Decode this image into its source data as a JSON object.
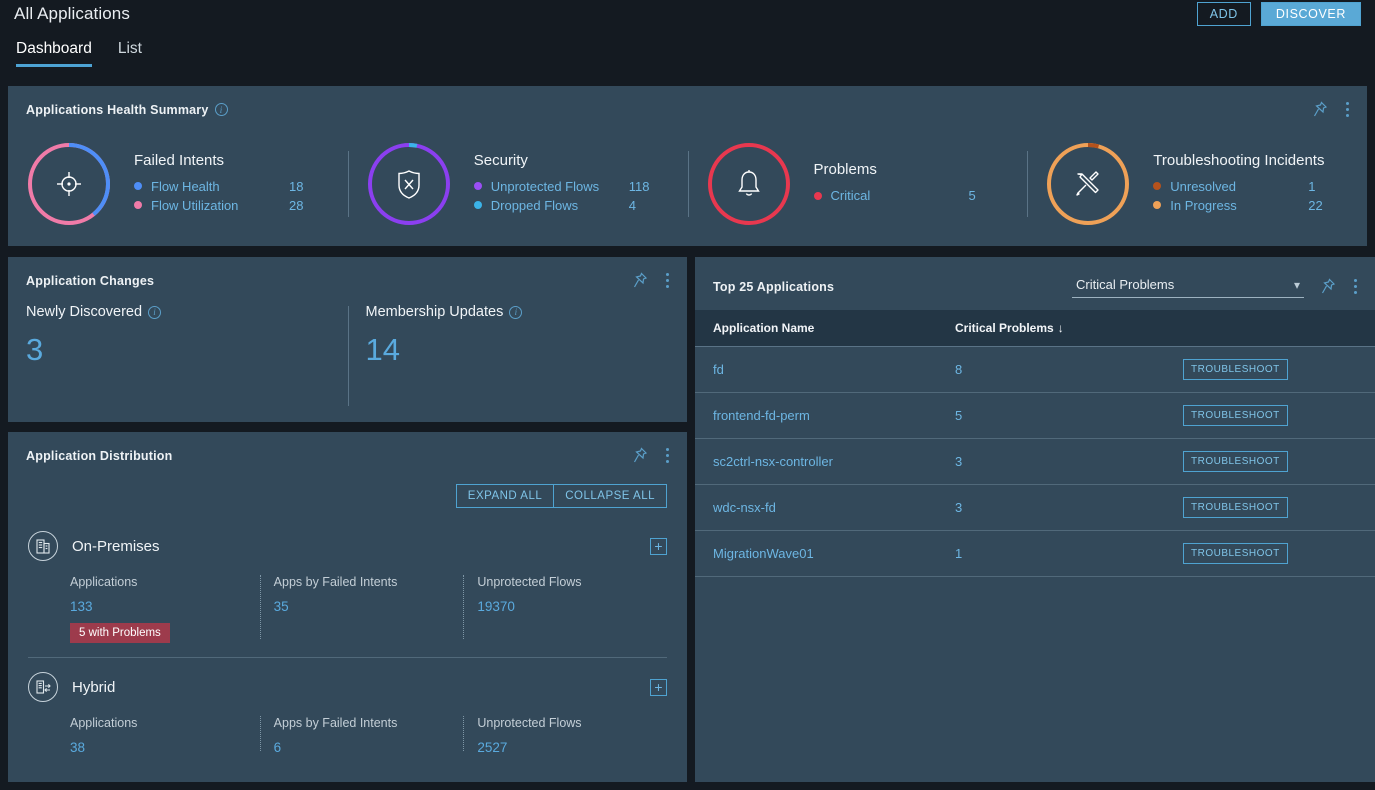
{
  "header": {
    "title": "All Applications",
    "add_label": "ADD",
    "discover_label": "DISCOVER",
    "tabs": [
      {
        "label": "Dashboard",
        "active": true
      },
      {
        "label": "List",
        "active": false
      }
    ]
  },
  "health_summary": {
    "title": "Applications Health Summary",
    "info_glyph": "i",
    "items": [
      {
        "name": "Failed Intents",
        "icon": "target-icon",
        "ring_colors": [
          "#f07ba8",
          "#4e8ef7"
        ],
        "legend": [
          {
            "label": "Flow Health",
            "value": "18",
            "color": "#4e8ef7"
          },
          {
            "label": "Flow Utilization",
            "value": "28",
            "color": "#f07ba8"
          }
        ]
      },
      {
        "name": "Security",
        "icon": "shield-x-icon",
        "ring_colors": [
          "#8b3ff0",
          "#3bb3e8"
        ],
        "legend": [
          {
            "label": "Unprotected Flows",
            "value": "118",
            "color": "#9b4ff5"
          },
          {
            "label": "Dropped Flows",
            "value": "4",
            "color": "#3bb3e8"
          }
        ]
      },
      {
        "name": "Problems",
        "icon": "bell-icon",
        "ring_colors": [
          "#e8384f",
          "#e8384f"
        ],
        "legend": [
          {
            "label": "Critical",
            "value": "5",
            "color": "#e8384f"
          }
        ]
      },
      {
        "name": "Troubleshooting Incidents",
        "icon": "tools-icon",
        "ring_colors": [
          "#efa157",
          "#b5521c"
        ],
        "legend": [
          {
            "label": "Unresolved",
            "value": "1",
            "color": "#b5521c"
          },
          {
            "label": "In Progress",
            "value": "22",
            "color": "#efa157"
          }
        ]
      }
    ]
  },
  "application_changes": {
    "title": "Application Changes",
    "items": [
      {
        "label": "Newly Discovered",
        "value": "3"
      },
      {
        "label": "Membership Updates",
        "value": "14"
      }
    ]
  },
  "application_distribution": {
    "title": "Application Distribution",
    "expand_all_label": "EXPAND ALL",
    "collapse_all_label": "COLLAPSE ALL",
    "groups": [
      {
        "name": "On-Premises",
        "icon": "building-icon",
        "expand_glyph": "+",
        "stats": [
          {
            "label": "Applications",
            "value": "133",
            "badge": "5 with Problems"
          },
          {
            "label": "Apps by Failed Intents",
            "value": "35",
            "badge": null
          },
          {
            "label": "Unprotected Flows",
            "value": "19370",
            "badge": null
          }
        ]
      },
      {
        "name": "Hybrid",
        "icon": "hybrid-cloud-icon",
        "expand_glyph": "+",
        "stats": [
          {
            "label": "Applications",
            "value": "38",
            "badge": null
          },
          {
            "label": "Apps by Failed Intents",
            "value": "6",
            "badge": null
          },
          {
            "label": "Unprotected Flows",
            "value": "2527",
            "badge": null
          }
        ]
      }
    ]
  },
  "top_applications": {
    "title": "Top 25 Applications",
    "filter_selected": "Critical Problems",
    "filter_options": [
      "Critical Problems"
    ],
    "columns": [
      "Application Name",
      "Critical Problems"
    ],
    "sort_glyph": "↓",
    "action_label": "TROUBLESHOOT",
    "rows": [
      {
        "name": "fd",
        "critical_problems": "8"
      },
      {
        "name": "frontend-fd-perm",
        "critical_problems": "5"
      },
      {
        "name": "sc2ctrl-nsx-controller",
        "critical_problems": "3"
      },
      {
        "name": "wdc-nsx-fd",
        "critical_problems": "3"
      },
      {
        "name": "MigrationWave01",
        "critical_problems": "1"
      }
    ]
  },
  "colors": {
    "page_background": "#141a21",
    "card_background": "#33495a",
    "accent_blue": "#4da3d4",
    "link_blue": "#6db6e3",
    "badge_red": "#9d3b4c",
    "table_header": "#233645"
  }
}
